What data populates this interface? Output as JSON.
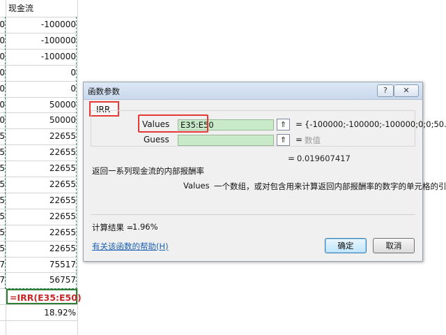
{
  "sheet": {
    "header": "现金流",
    "rows": [
      {
        "left": "0",
        "value": "-100000"
      },
      {
        "left": "0",
        "value": "-100000"
      },
      {
        "left": "0",
        "value": "-100000"
      },
      {
        "left": "0",
        "value": "0"
      },
      {
        "left": "0",
        "value": "0"
      },
      {
        "left": "0",
        "value": "50000"
      },
      {
        "left": "0",
        "value": "50000"
      },
      {
        "left": "5",
        "value": "22655"
      },
      {
        "left": "5",
        "value": "22655"
      },
      {
        "left": "5",
        "value": "22655"
      },
      {
        "left": "5",
        "value": "22655"
      },
      {
        "left": "5",
        "value": "22655"
      },
      {
        "left": "5",
        "value": "22655"
      },
      {
        "left": "5",
        "value": "22655"
      },
      {
        "left": "5",
        "value": "22655"
      },
      {
        "left": "7",
        "value": "75517"
      },
      {
        "left": "7",
        "value": "56757"
      }
    ],
    "formula_cell": "=IRR(E35:E50)",
    "result_cell": "18.92%",
    "marquee_color": "#2e8b57",
    "highlight_color": "#e53935"
  },
  "dialog": {
    "title": "函数参数",
    "help_button": "?",
    "close_button": "✕",
    "function_name": "IRR",
    "args": [
      {
        "label": "Values",
        "input": "E35:E50",
        "evaluated": "{-100000;-100000;-100000;0;0;50..."
      },
      {
        "label": "Guess",
        "input": "",
        "evaluated": "数值"
      }
    ],
    "ref_icon": "⇑",
    "equals": "=",
    "result_value": "0.019607417",
    "description": "返回一系列现金流的内部报酬率",
    "arg_desc_name": "Values",
    "arg_desc_text": "一个数组，或对包含用来计算返回内部报酬率的数字的单元格的引用",
    "calc_result_label": "计算结果 =",
    "calc_result_value": "1.96%",
    "help_link": "有关该函数的帮助(H)",
    "ok_label": "确定",
    "cancel_label": "取消",
    "input_bg": "#c9eac9"
  }
}
